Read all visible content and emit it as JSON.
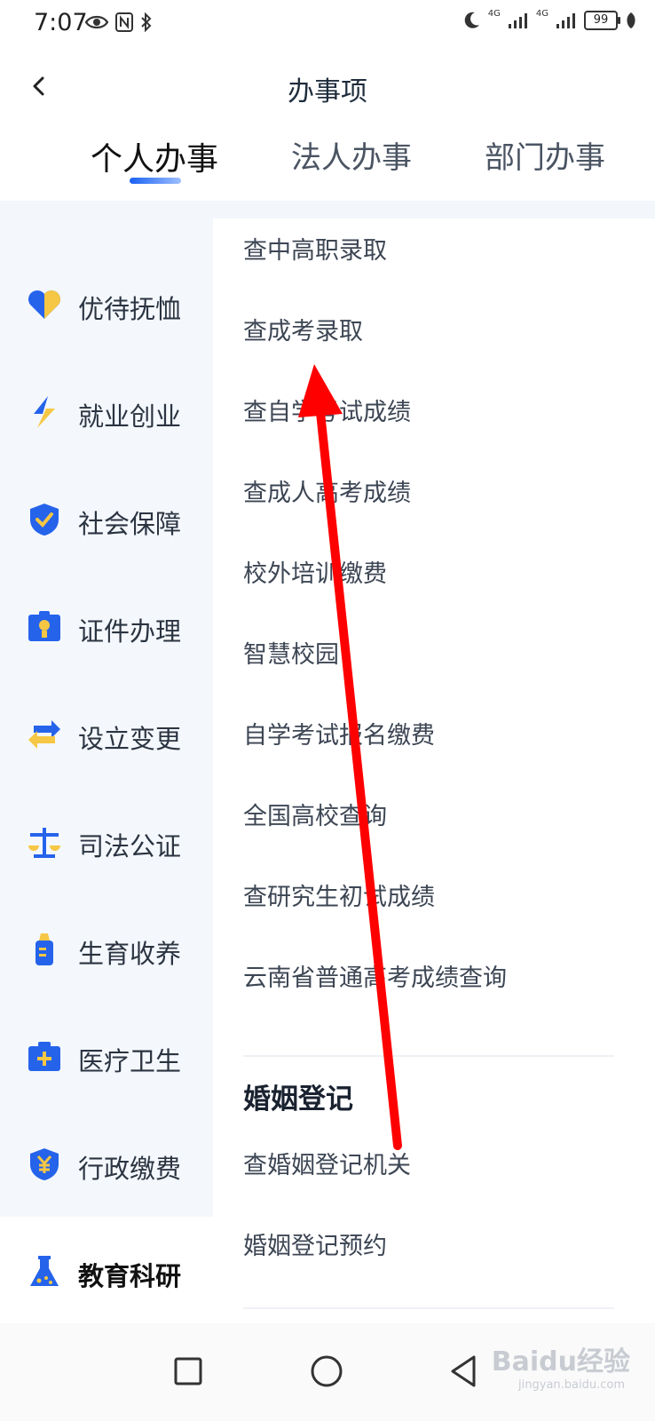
{
  "status": {
    "time": "7:07",
    "signal1": "4G",
    "signal2": "4G",
    "battery": "99"
  },
  "header": {
    "title": "办事项"
  },
  "tabs": [
    {
      "label": "个人办事",
      "active": true
    },
    {
      "label": "法人办事",
      "active": false
    },
    {
      "label": "部门办事",
      "active": false
    }
  ],
  "sidebar": {
    "items": [
      {
        "label": "优待抚恤",
        "icon": "heart-icon"
      },
      {
        "label": "就业创业",
        "icon": "lightning-icon"
      },
      {
        "label": "社会保障",
        "icon": "shield-check-icon"
      },
      {
        "label": "证件办理",
        "icon": "id-card-icon"
      },
      {
        "label": "设立变更",
        "icon": "swap-arrows-icon"
      },
      {
        "label": "司法公证",
        "icon": "scales-icon"
      },
      {
        "label": "生育收养",
        "icon": "baby-bottle-icon"
      },
      {
        "label": "医疗卫生",
        "icon": "medical-kit-icon"
      },
      {
        "label": "行政缴费",
        "icon": "yuan-coin-icon"
      },
      {
        "label": "教育科研",
        "icon": "flask-icon",
        "active": true
      }
    ]
  },
  "content": {
    "items": [
      "查中高职录取",
      "查成考录取",
      "查自学考试成绩",
      "查成人高考成绩",
      "校外培训缴费",
      "智慧校园",
      "自学考试报名缴费",
      "全国高校查询",
      "查研究生初试成绩",
      "云南省普通高考成绩查询"
    ],
    "section": {
      "title": "婚姻登记",
      "items": [
        "查婚姻登记机关",
        "婚姻登记预约"
      ]
    }
  },
  "watermark": {
    "text": "Baidu经验",
    "url": "jingyan.baidu.com"
  },
  "colors": {
    "accent": "#1a61f2",
    "sidebar_bg": "#f4f8fd",
    "arrow": "#ff0000"
  }
}
